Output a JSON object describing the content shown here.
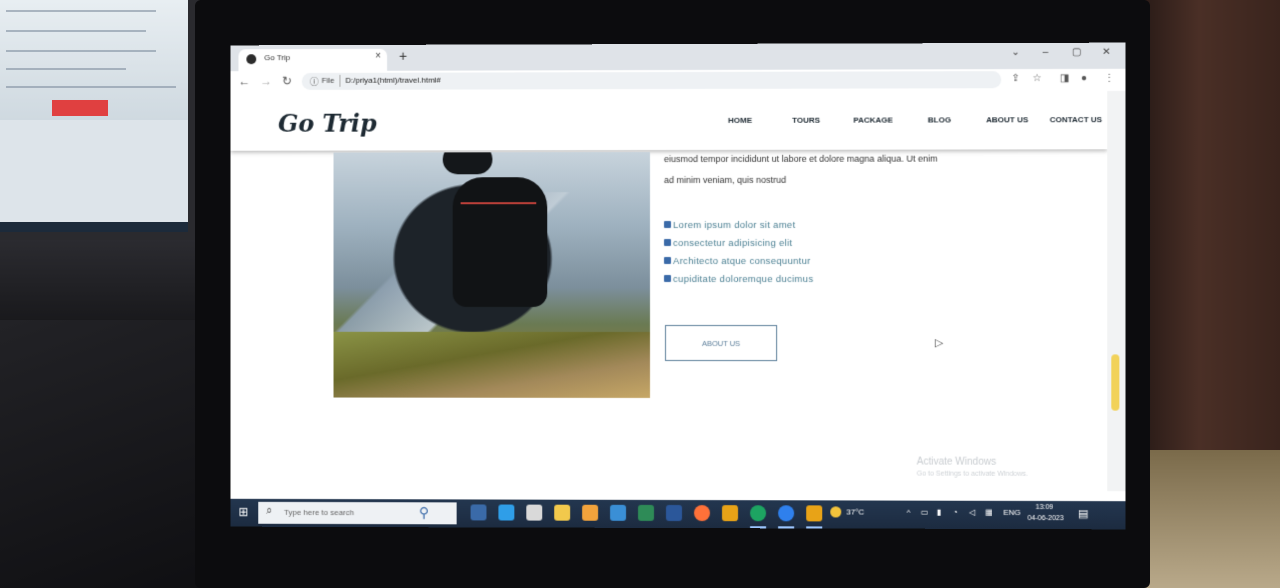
{
  "browser": {
    "tab_title": "Go Trip",
    "tab_close": "×",
    "new_tab": "+",
    "url_scheme": "File",
    "url": "D:/priya1(html)/travel.html#",
    "window_controls": {
      "dropdown": "⌄",
      "minimize": "–",
      "maximize": "▢",
      "close": "✕"
    },
    "nav_icons": {
      "back": "←",
      "forward": "→",
      "reload": "↻",
      "info": "ⓘ"
    },
    "toolbar_icons": {
      "share": "⇪",
      "star": "☆",
      "sidepanel": "◨",
      "profile": "●",
      "menu": "⋮"
    }
  },
  "site": {
    "logo": "Go Trip",
    "nav": [
      "HOME",
      "TOURS",
      "PACKAGE",
      "BLOG",
      "ABOUT US",
      "CONTACT US"
    ]
  },
  "content": {
    "paragraph_lines": [
      "eiusmod tempor incididunt ut labore et dolore magna aliqua. Ut enim",
      "ad minim veniam, quis nostrud"
    ],
    "checklist": [
      "Lorem ipsum dolor sit amet",
      "consectetur adipisicing elit",
      "Architecto atque consequuntur",
      "cupiditate doloremque ducimus"
    ],
    "button_label": "ABOUT US",
    "watermark_title": "Activate Windows",
    "watermark_sub": "Go to Settings to activate Windows."
  },
  "taskbar": {
    "start_icon": "⊞",
    "search_placeholder": "Type here to search",
    "search_icon": "⌕",
    "weather": "37°C",
    "tray_chevron": "^",
    "language": "ENG",
    "time": "13:09",
    "date": "04-06-2023",
    "notification_icon": "▤",
    "app_colors": [
      "#3a6aa8",
      "#2f9ee8",
      "#d9d9d9",
      "#f2c94c",
      "#f2a33c",
      "#3a8fd6",
      "#2e8b57",
      "#2b579a",
      "#ff7139",
      "#e8a317",
      "#1da462",
      "#2f80ed",
      "#e8a317"
    ]
  }
}
